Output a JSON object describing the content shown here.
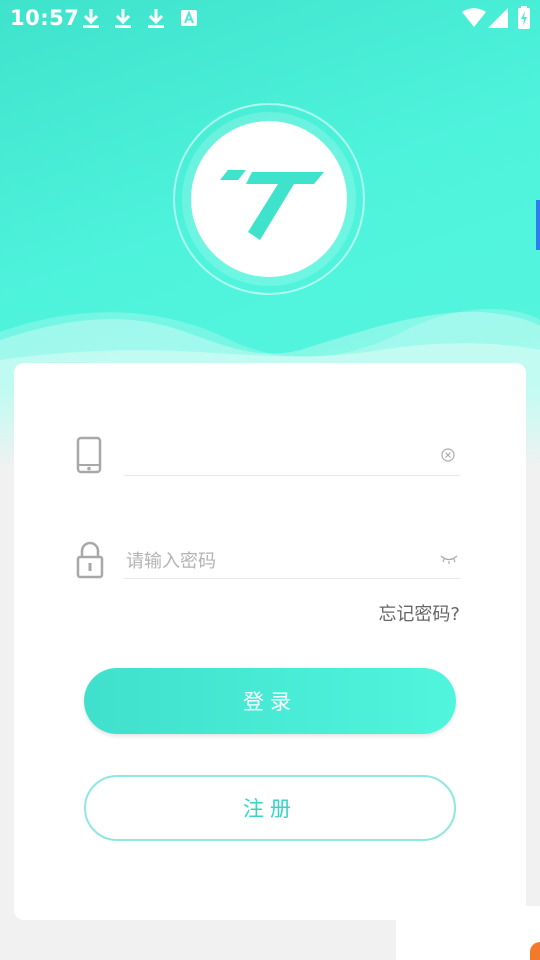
{
  "status_bar": {
    "time": "10:57",
    "left_icons": [
      "download-icon",
      "download-icon",
      "download-icon",
      "keyboard-a-icon"
    ],
    "right_icons": [
      "wifi-icon",
      "cell-signal-icon",
      "battery-charging-icon"
    ]
  },
  "logo": {
    "icon": "app-logo-t-icon",
    "color": "#3fe3cc"
  },
  "form": {
    "phone": {
      "value": "",
      "placeholder": "",
      "lead_icon": "phone-icon",
      "trail_icon": "clear-icon"
    },
    "password": {
      "value": "",
      "placeholder": "请输入密码",
      "lead_icon": "lock-icon",
      "trail_icon": "eye-closed-icon"
    },
    "forgot_label": "忘记密码?",
    "login_label": "登录",
    "register_label": "注册"
  },
  "colors": {
    "accent": "#3fe3cc",
    "accent_light": "#50f5dd",
    "register_text": "#35d3c8",
    "placeholder": "#b3b3b3",
    "background": "#f1f1f1"
  }
}
